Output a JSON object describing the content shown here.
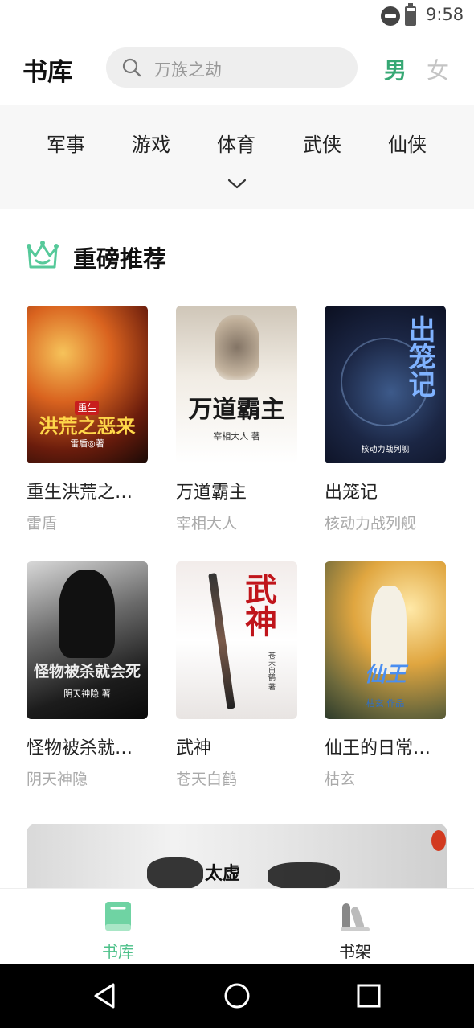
{
  "status_bar": {
    "time": "9:58",
    "battery_level_percent": 80,
    "icons": [
      "do-not-disturb-icon",
      "battery-icon"
    ]
  },
  "header": {
    "title": "书库",
    "search": {
      "placeholder": "万族之劫",
      "icon": "search-icon"
    },
    "gender_tabs": [
      {
        "label": "男",
        "selected": true
      },
      {
        "label": "女",
        "selected": false
      }
    ]
  },
  "categories": {
    "items": [
      "军事",
      "游戏",
      "体育",
      "武侠",
      "仙侠"
    ],
    "expand_icon": "chevron-down-icon"
  },
  "section": {
    "title": "重磅推荐",
    "icon": "crown-icon",
    "books": [
      {
        "name": "重生洪荒之…",
        "author": "雷盾",
        "cover_title": "洪荒之恶来",
        "cover_tag": "重生",
        "cover_author": "雷盾◎著"
      },
      {
        "name": "万道霸主",
        "author": "宰相大人",
        "cover_title": "万道霸主",
        "cover_author": "宰相大人 著"
      },
      {
        "name": "出笼记",
        "author": "核动力战列舰",
        "cover_title": "出笼记",
        "cover_author": "核动力战列舰"
      },
      {
        "name": "怪物被杀就…",
        "author": "阴天神隐",
        "cover_title": "怪物被杀就会死",
        "cover_author": "阴天神隐 著"
      },
      {
        "name": "武神",
        "author": "苍天白鹤",
        "cover_title": "武神",
        "cover_author": "苍天白鹤 著"
      },
      {
        "name": "仙王的日常…",
        "author": "枯玄",
        "cover_title": "仙王",
        "cover_author": "枯玄 作品"
      }
    ]
  },
  "banner": {
    "title": "太虚"
  },
  "bottom_nav": {
    "items": [
      {
        "label": "书库",
        "icon": "book-icon",
        "active": true
      },
      {
        "label": "书架",
        "icon": "bookshelf-icon",
        "active": false
      }
    ]
  },
  "system_nav": {
    "buttons": [
      "back-icon",
      "home-icon",
      "recents-icon"
    ]
  },
  "colors": {
    "accent": "#4cc089",
    "accent_dark": "#36a874",
    "category_bg": "#f7f7f7",
    "search_bg": "#eeeeee"
  }
}
